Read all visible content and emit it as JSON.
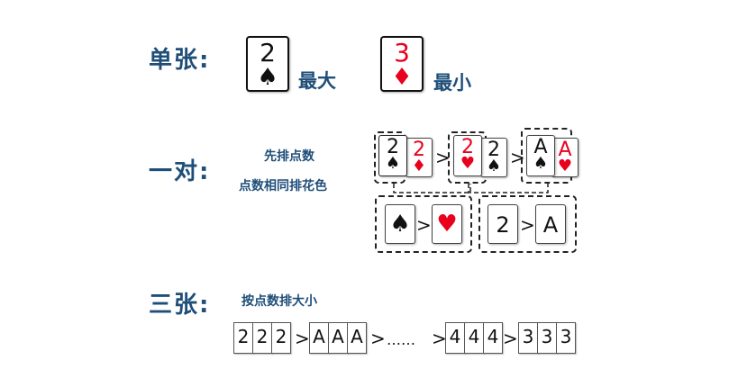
{
  "single": {
    "heading": "单张:",
    "largest_card": {
      "rank": "2",
      "suit": "♠"
    },
    "largest_label": "最大",
    "smallest_card": {
      "rank": "3",
      "suit": "♦"
    },
    "smallest_label": "最小"
  },
  "pair": {
    "heading": "一对:",
    "rule_line1": "先排点数",
    "rule_line2": "点数相同排花色",
    "gt": ">",
    "group1": {
      "front": {
        "rank": "2",
        "suit": "♠"
      },
      "back": {
        "rank": "2",
        "suit": "♦"
      }
    },
    "group2": {
      "front": {
        "rank": "2",
        "suit": "♥"
      },
      "back": {
        "rank": "2",
        "suit": "♠"
      }
    },
    "group3": {
      "front": {
        "rank": "A",
        "suit": "♠"
      },
      "back": {
        "rank": "A",
        "suit": "♥"
      }
    },
    "suit_compare": {
      "left": "♠",
      "right": "♥"
    },
    "rank_compare": {
      "left": "2",
      "right": "A"
    }
  },
  "triple": {
    "heading": "三张:",
    "rule": "按点数排大小",
    "gt": ">",
    "ellipsis": "……",
    "groups": [
      {
        "ranks": [
          "2",
          "2",
          "2"
        ]
      },
      {
        "ranks": [
          "A",
          "A",
          "A"
        ]
      },
      {
        "ranks": [
          "4",
          "4",
          "4"
        ]
      },
      {
        "ranks": [
          "3",
          "3",
          "3"
        ]
      }
    ]
  }
}
